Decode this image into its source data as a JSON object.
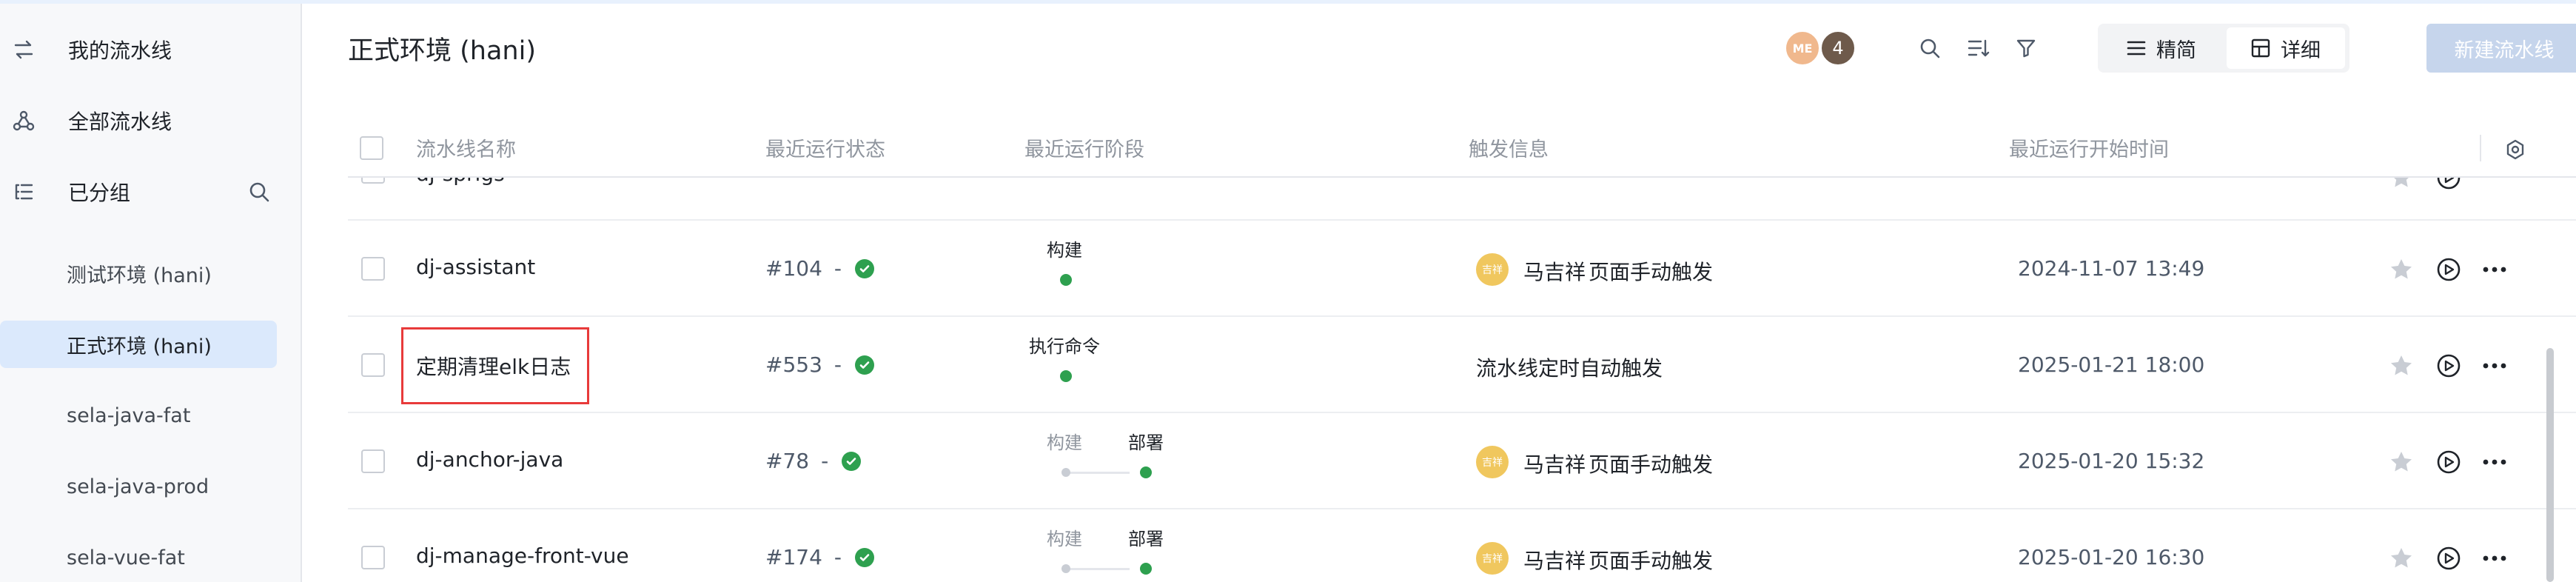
{
  "sidebar": {
    "my_pipelines": "我的流水线",
    "all_pipelines": "全部流水线",
    "grouped": "已分组",
    "groups": [
      {
        "label": "测试环境 (hani)"
      },
      {
        "label": "正式环境 (hani)",
        "active": true
      },
      {
        "label": "sela-java-fat"
      },
      {
        "label": "sela-java-prod"
      },
      {
        "label": "sela-vue-fat"
      }
    ]
  },
  "header": {
    "title": "正式环境 (hani)",
    "avatars": {
      "me": "ME",
      "more": "4"
    },
    "view_simple": "精简",
    "view_detail": "详细",
    "new_button": "新建流水线"
  },
  "table": {
    "columns": [
      "流水线名称",
      "最近运行状态",
      "最近运行阶段",
      "触发信息",
      "最近运行开始时间"
    ],
    "partial_row_name": "dj-sprigs",
    "rows": [
      {
        "name": "dj-assistant",
        "run_number": "#104",
        "run_sep": "-",
        "stages": [
          {
            "label": "构建",
            "done": true
          }
        ],
        "trigger_avatar": "吉祥",
        "trigger_user": "马吉祥",
        "trigger_text": "页面手动触发",
        "start_time": "2024-11-07 13:49"
      },
      {
        "name": "定期清理elk日志",
        "highlighted": true,
        "run_number": "#553",
        "run_sep": "-",
        "stages": [
          {
            "label": "执行命令",
            "done": true
          }
        ],
        "trigger_text": "流水线定时自动触发",
        "start_time": "2025-01-21 18:00"
      },
      {
        "name": "dj-anchor-java",
        "run_number": "#78",
        "run_sep": "-",
        "stages": [
          {
            "label": "构建",
            "done": false
          },
          {
            "label": "部署",
            "done": true
          }
        ],
        "trigger_avatar": "吉祥",
        "trigger_user": "马吉祥",
        "trigger_text": "页面手动触发",
        "start_time": "2025-01-20 15:32"
      },
      {
        "name": "dj-manage-front-vue",
        "run_number": "#174",
        "run_sep": "-",
        "stages": [
          {
            "label": "构建",
            "done": false
          },
          {
            "label": "部署",
            "done": true
          }
        ],
        "trigger_avatar": "吉祥",
        "trigger_user": "马吉祥",
        "trigger_text": "页面手动触发",
        "start_time": "2025-01-20 16:30"
      }
    ]
  },
  "colors": {
    "accent": "#dbe9fc",
    "success": "#2ea04f",
    "highlight_border": "#e83a3a",
    "new_button_disabled": "#c6d5ec"
  }
}
